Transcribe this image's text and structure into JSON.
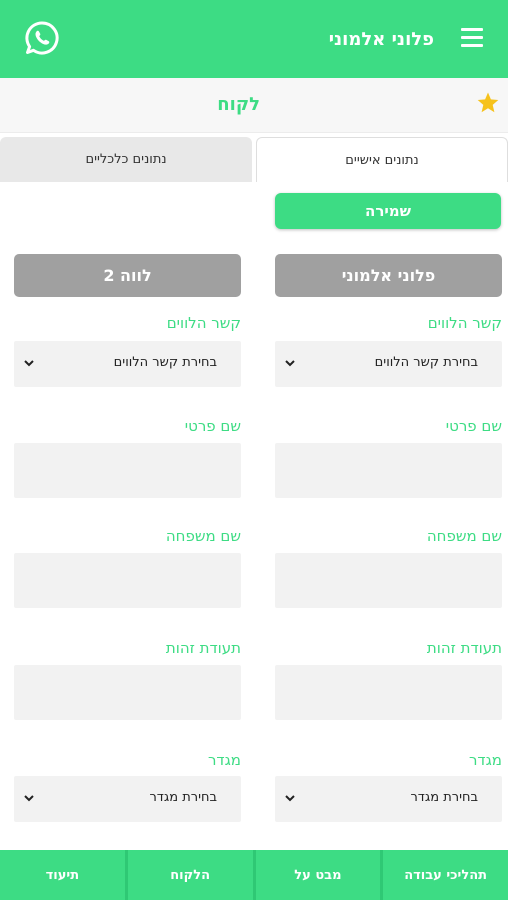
{
  "app": {
    "title": "פלוני אלמוני",
    "whatsapp_icon": "whatsapp-icon",
    "menu_icon": "menu-icon"
  },
  "subheader": {
    "title": "לקוח",
    "star_icon": "star-icon"
  },
  "tabs": [
    {
      "label": "נתונים אישיים",
      "active": true
    },
    {
      "label": "נתונים כלכליים",
      "active": false
    }
  ],
  "save_label": "שמירה",
  "columns": [
    {
      "header": "פלוני אלמוני",
      "relation_label": "קשר הלווים",
      "relation_value": "בחירת קשר הלווים",
      "first_name_label": "שם פרטי",
      "first_name_value": "",
      "last_name_label": "שם משפחה",
      "last_name_value": "",
      "id_label": "תעודת זהות",
      "id_value": "",
      "gender_label": "מגדר",
      "gender_value": "בחירת מגדר"
    },
    {
      "header": "לווה 2",
      "relation_label": "קשר הלווים",
      "relation_value": "בחירת קשר הלווים",
      "first_name_label": "שם פרטי",
      "first_name_value": "",
      "last_name_label": "שם משפחה",
      "last_name_value": "",
      "id_label": "תעודת זהות",
      "id_value": "",
      "gender_label": "מגדר",
      "gender_value": "בחירת מגדר"
    }
  ],
  "bottom_nav": [
    {
      "label": "תהליכי עבודה"
    },
    {
      "label": "מבט על"
    },
    {
      "label": "הלקוח"
    },
    {
      "label": "תיעוד"
    }
  ],
  "colors": {
    "accent": "#3ddc84",
    "header_grey": "#a0a0a0",
    "field_bg": "#f2f2f2"
  }
}
